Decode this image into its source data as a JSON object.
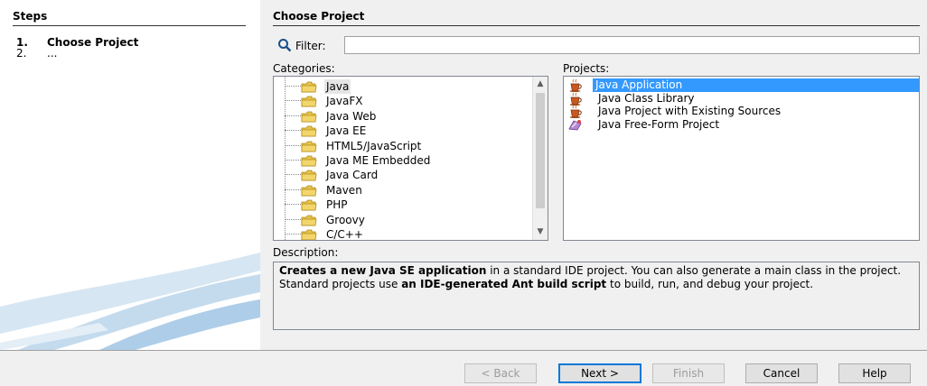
{
  "steps": {
    "title": "Steps",
    "items": [
      {
        "num": "1.",
        "label": "Choose Project"
      },
      {
        "num": "2.",
        "label": "..."
      }
    ]
  },
  "main": {
    "title": "Choose Project",
    "filter_label": "Filter:",
    "filter_value": "",
    "categories_label": "Categories:",
    "projects_label": "Projects:",
    "description_label": "Description:"
  },
  "categories": [
    "Java",
    "JavaFX",
    "Java Web",
    "Java EE",
    "HTML5/JavaScript",
    "Java ME Embedded",
    "Java Card",
    "Maven",
    "PHP",
    "Groovy",
    "C/C++"
  ],
  "projects": [
    {
      "label": "Java Application",
      "icon": "coffee-cup-icon"
    },
    {
      "label": "Java Class Library",
      "icon": "coffee-cup-icon"
    },
    {
      "label": "Java Project with Existing Sources",
      "icon": "coffee-cup-icon"
    },
    {
      "label": "Java Free-Form Project",
      "icon": "freeform-icon"
    }
  ],
  "description": {
    "bold1": "Creates a new Java SE application",
    "text1": " in a standard IDE project. You can also generate a main class in the project. Standard projects use ",
    "bold2": "an IDE-generated Ant build script",
    "text2": " to build, run, and debug your project."
  },
  "buttons": {
    "back": "< Back",
    "next": "Next >",
    "finish": "Finish",
    "cancel": "Cancel",
    "help": "Help"
  },
  "colors": {
    "selection": "#3399ff",
    "folder": "#e8c44a"
  }
}
